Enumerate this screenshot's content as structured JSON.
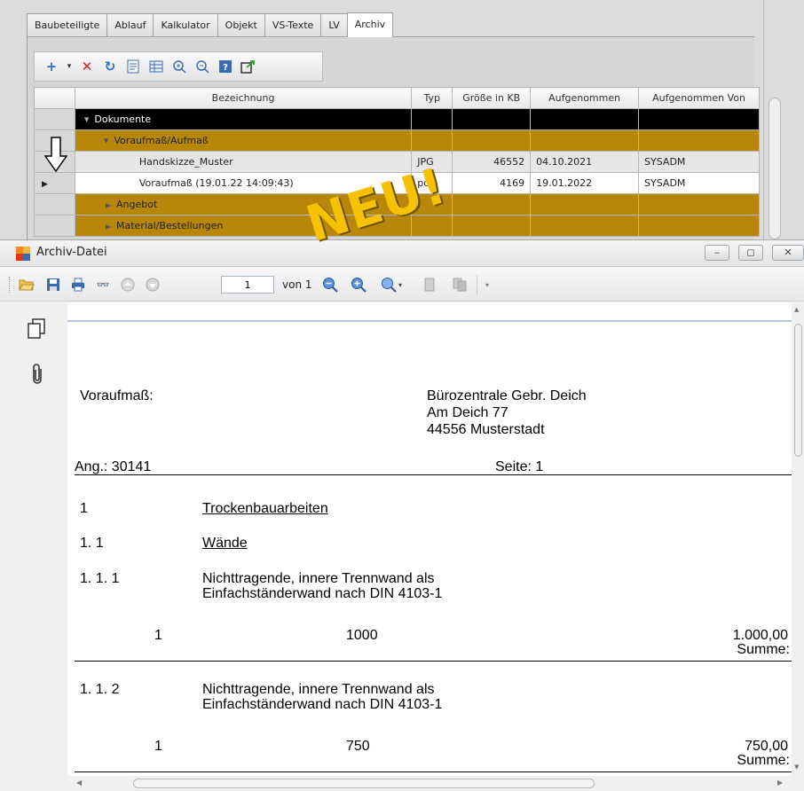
{
  "tabs": [
    "Baubeteiligte",
    "Ablauf",
    "Kalkulator",
    "Objekt",
    "VS-Texte",
    "LV",
    "Archiv"
  ],
  "active_tab": "Archiv",
  "grid": {
    "columns": [
      "Bezeichnung",
      "Typ",
      "Größe in KB",
      "Aufgenommen",
      "Aufgenommen Von"
    ],
    "root": "Dokumente",
    "folder1": "Voraufmaß/Aufmaß",
    "files": [
      {
        "name": "Handskizze_Muster",
        "typ": "JPG",
        "size": "46552",
        "date": "04.10.2021",
        "by": "SYSADM"
      },
      {
        "name": "Voraufmaß (19.01.22 14:09:43)",
        "typ": "pdf",
        "size": "4169",
        "date": "19.01.2022",
        "by": "SYSADM"
      }
    ],
    "folder2": "Angebot",
    "folder3": "Material/Bestellungen"
  },
  "stamp": "NEU!",
  "viewer": {
    "title": "Archiv-Datei",
    "page_value": "1",
    "page_of": "von 1"
  },
  "doc": {
    "label": "Voraufmaß:",
    "addr1": "Bürozentrale Gebr. Deich",
    "addr2": "Am Deich 77",
    "addr3": "44556 Musterstadt",
    "ang": "Ang.: 30141",
    "seite": "Seite: 1",
    "s1_num": "1",
    "s1_title": "Trockenbauarbeiten",
    "s11_num": "1. 1",
    "s11_title": "Wände",
    "p1_num": "1. 1.  1",
    "p1_l1": "Nichttragende, innere Trennwand als",
    "p1_l2": "Einfachständerwand nach DIN 4103-1",
    "p1_qty": "1",
    "p1_val": "1000",
    "p1_total": "1.000,00",
    "sum_label": "Summe:",
    "p2_num": "1. 1.  2",
    "p2_l1": "Nichttragende, innere Trennwand als",
    "p2_l2": "Einfachständerwand nach DIN 4103-1",
    "p2_qty": "1",
    "p2_val": "750",
    "p2_total": "750,00"
  }
}
